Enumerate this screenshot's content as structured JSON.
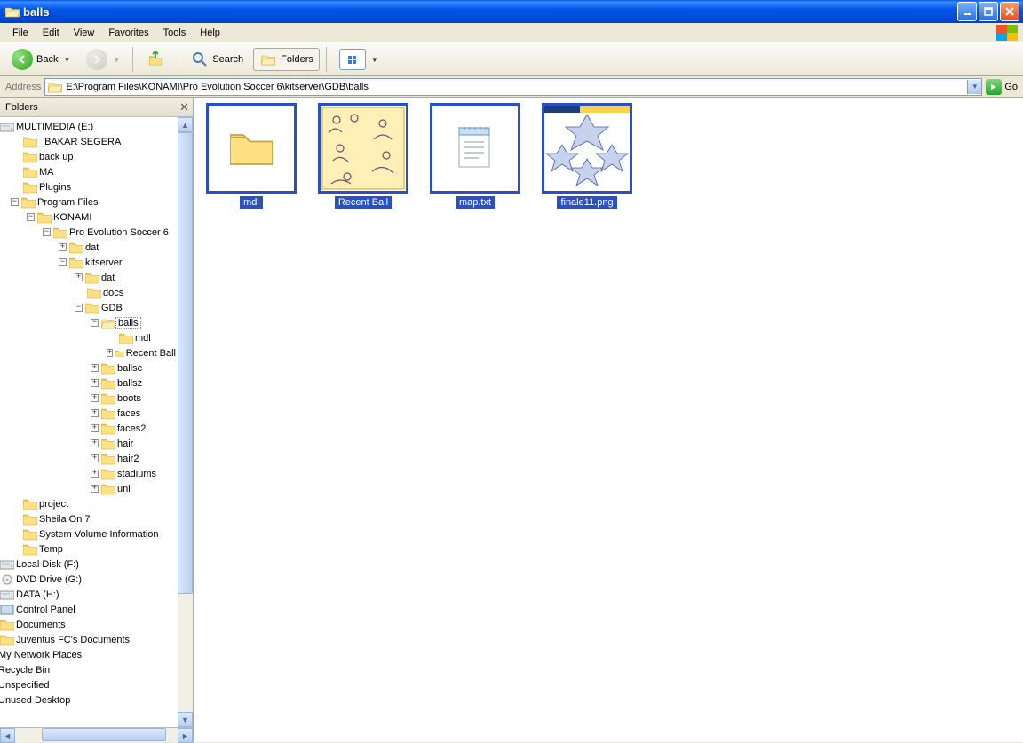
{
  "window": {
    "title": "balls"
  },
  "menu": {
    "file": "File",
    "edit": "Edit",
    "view": "View",
    "favorites": "Favorites",
    "tools": "Tools",
    "help": "Help"
  },
  "toolbar": {
    "back": "Back",
    "search": "Search",
    "folders": "Folders"
  },
  "address": {
    "label": "Address",
    "path": "E:\\Program Files\\KONAMI\\Pro Evolution Soccer 6\\kitserver\\GDB\\balls",
    "go": "Go"
  },
  "sidebar": {
    "title": "Folders"
  },
  "tree": {
    "n0": "MULTIMEDIA (E:)",
    "n1": "_BAKAR SEGERA",
    "n2": "back up",
    "n3": "MA",
    "n4": "Plugins",
    "n5": "Program Files",
    "n6": "KONAMI",
    "n7": "Pro Evolution Soccer 6",
    "n8": "dat",
    "n9": "kitserver",
    "n10": "dat",
    "n11": "docs",
    "n12": "GDB",
    "n13": "balls",
    "n14": "mdl",
    "n15": "Recent Ball",
    "n16": "ballsc",
    "n17": "ballsz",
    "n18": "boots",
    "n19": "faces",
    "n20": "faces2",
    "n21": "hair",
    "n22": "hair2",
    "n23": "stadiums",
    "n24": "uni",
    "n25": "project",
    "n26": "Sheila On 7",
    "n27": "System Volume Information",
    "n28": "Temp",
    "n29": "Local Disk (F:)",
    "n30": "DVD Drive (G:)",
    "n31": "DATA (H:)",
    "n32": "Control Panel",
    "n33": "Documents",
    "n34": "Juventus FC's Documents",
    "n35": "My Network Places",
    "n36": "Recycle Bin",
    "n37": "Unspecified",
    "n38": "Unused Desktop"
  },
  "items": {
    "i0": "mdl",
    "i1": "Recent Ball",
    "i2": "map.txt",
    "i3": "finale11.png"
  }
}
